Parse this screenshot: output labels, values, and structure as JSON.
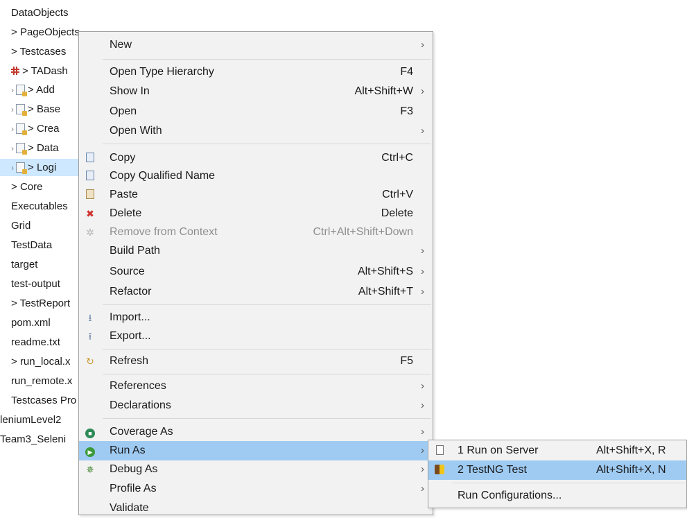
{
  "tree": {
    "items": [
      {
        "label": "DataObjects",
        "prefix": ""
      },
      {
        "label": "PageObjects",
        "prefix": "> "
      },
      {
        "label": "Testcases",
        "prefix": "> "
      },
      {
        "label": "TADash",
        "prefix": "> "
      },
      {
        "label": "Add",
        "prefix": "> "
      },
      {
        "label": "Base",
        "prefix": "> "
      },
      {
        "label": "Crea",
        "prefix": "> "
      },
      {
        "label": "Data",
        "prefix": "> "
      },
      {
        "label": "Logi",
        "prefix": "> "
      },
      {
        "label": "Core",
        "prefix": "> "
      },
      {
        "label": "Executables",
        "prefix": ""
      },
      {
        "label": "Grid",
        "prefix": ""
      },
      {
        "label": "TestData",
        "prefix": ""
      },
      {
        "label": "target",
        "prefix": ""
      },
      {
        "label": "test-output",
        "prefix": ""
      },
      {
        "label": "TestReport",
        "prefix": "> "
      },
      {
        "label": "pom.xml",
        "prefix": ""
      },
      {
        "label": "readme.txt",
        "prefix": ""
      },
      {
        "label": "run_local.x",
        "prefix": "> "
      },
      {
        "label": "run_remote.x",
        "prefix": ""
      },
      {
        "label": "Testcases Pro",
        "prefix": ""
      },
      {
        "label": "leniumLevel2",
        "prefix": ""
      },
      {
        "label": "Team3_Seleni",
        "prefix": ""
      }
    ]
  },
  "menu": {
    "new": "New",
    "open_type_hierarchy": "Open Type Hierarchy",
    "open_type_hierarchy_sc": "F4",
    "show_in": "Show In",
    "show_in_sc": "Alt+Shift+W",
    "open": "Open",
    "open_sc": "F3",
    "open_with": "Open With",
    "copy": "Copy",
    "copy_sc": "Ctrl+C",
    "copy_qualified": "Copy Qualified Name",
    "paste": "Paste",
    "paste_sc": "Ctrl+V",
    "delete": "Delete",
    "delete_sc": "Delete",
    "remove_from_context": "Remove from Context",
    "remove_from_context_sc": "Ctrl+Alt+Shift+Down",
    "build_path": "Build Path",
    "source": "Source",
    "source_sc": "Alt+Shift+S",
    "refactor": "Refactor",
    "refactor_sc": "Alt+Shift+T",
    "import": "Import...",
    "export": "Export...",
    "refresh": "Refresh",
    "refresh_sc": "F5",
    "references": "References",
    "declarations": "Declarations",
    "coverage_as": "Coverage As",
    "run_as": "Run As",
    "debug_as": "Debug As",
    "profile_as": "Profile As",
    "validate": "Validate",
    "arrow": "›"
  },
  "submenu": {
    "run_on_server": "1 Run on Server",
    "run_on_server_sc": "Alt+Shift+X, R",
    "testng_test": "2 TestNG Test",
    "testng_test_sc": "Alt+Shift+X, N",
    "run_configurations": "Run Configurations..."
  },
  "colors": {
    "highlight": "#9fcbf2",
    "selected_tree": "#cde8ff",
    "menu_bg": "#f2f2f2"
  }
}
